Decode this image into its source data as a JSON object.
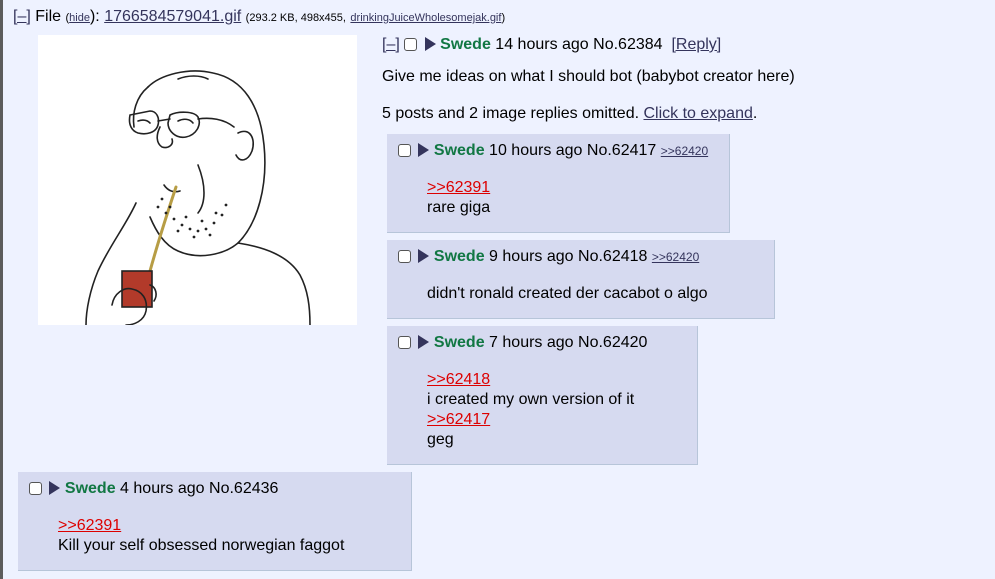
{
  "file": {
    "toggle": "[–]",
    "label": "File",
    "hide_open": "(",
    "hide": "hide",
    "hide_close": "):",
    "filename": "1766584579041.gif",
    "info_open": "(293.2 KB, 498x455,",
    "original_name": "drinkingJuiceWholesomejak.gif",
    "info_close": ")"
  },
  "op": {
    "toggle": "[–]",
    "name": "Swede",
    "time": "14 hours ago",
    "number": "No.62384",
    "reply_label": "[Reply]",
    "message": "Give me ideas on what I should bot (babybot creator here)",
    "omitted": "5 posts and 2 image replies omitted.",
    "expand": "Click to expand",
    "period": "."
  },
  "replies": [
    {
      "name": "Swede",
      "time": "10 hours ago",
      "number": "No.62417",
      "backlink": ">>62420",
      "lines": [
        ">>62391",
        "rare giga"
      ]
    },
    {
      "name": "Swede",
      "time": "9 hours ago",
      "number": "No.62418",
      "backlink": ">>62420",
      "lines": [
        "didn't ronald created der cacabot o algo"
      ]
    },
    {
      "name": "Swede",
      "time": "7 hours ago",
      "number": "No.62420",
      "lines": [
        ">>62418",
        "i created my own version of it",
        ">>62417",
        "geg"
      ]
    },
    {
      "name": "Swede",
      "time": "4 hours ago",
      "number": "No.62436",
      "lines": [
        ">>62391",
        "Kill your self obsessed norwegian faggot"
      ]
    }
  ]
}
